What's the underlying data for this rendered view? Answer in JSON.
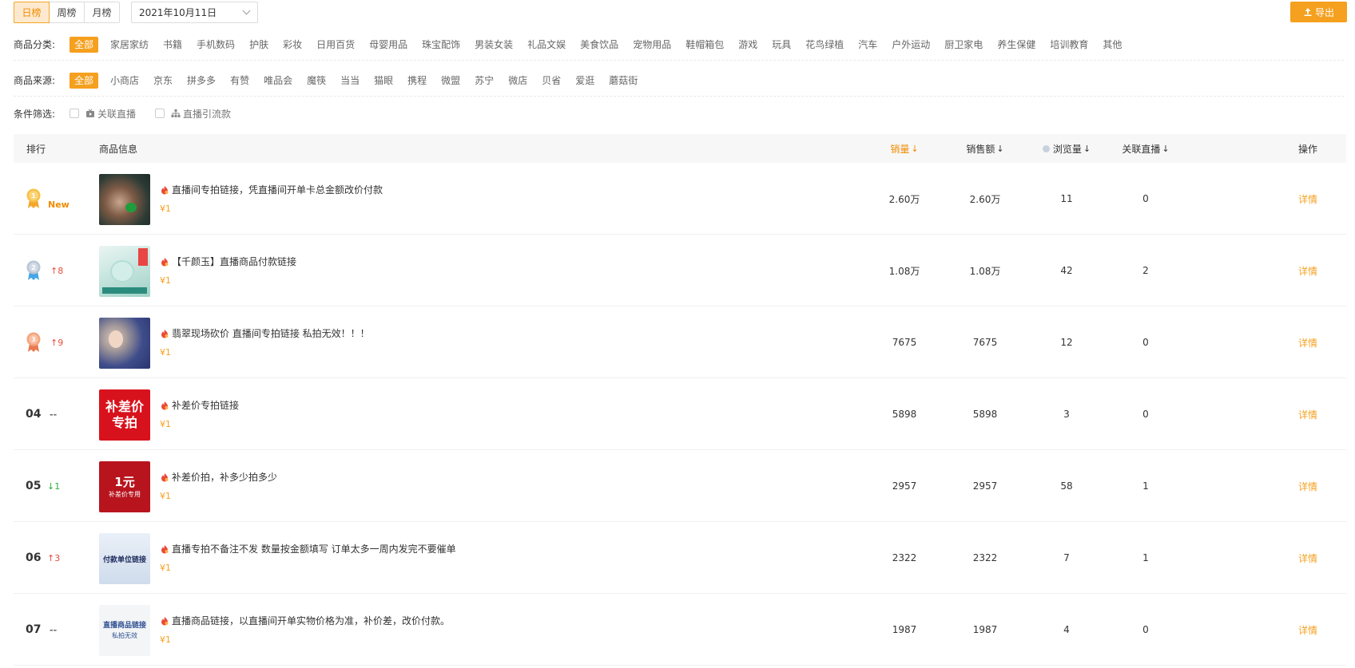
{
  "tabs": [
    {
      "label": "日榜",
      "active": true
    },
    {
      "label": "周榜",
      "active": false
    },
    {
      "label": "月榜",
      "active": false
    }
  ],
  "date_picker": {
    "value": "2021年10月11日"
  },
  "export_label": "导出",
  "category": {
    "label": "商品分类:",
    "items": [
      "全部",
      "家居家纺",
      "书籍",
      "手机数码",
      "护肤",
      "彩妆",
      "日用百货",
      "母婴用品",
      "珠宝配饰",
      "男装女装",
      "礼品文娱",
      "美食饮品",
      "宠物用品",
      "鞋帽箱包",
      "游戏",
      "玩具",
      "花鸟绿植",
      "汽车",
      "户外运动",
      "厨卫家电",
      "养生保健",
      "培训教育",
      "其他"
    ]
  },
  "source": {
    "label": "商品来源:",
    "items": [
      "全部",
      "小商店",
      "京东",
      "拼多多",
      "有赞",
      "唯品会",
      "魔筷",
      "当当",
      "猫眼",
      "携程",
      "微盟",
      "苏宁",
      "微店",
      "贝省",
      "爱逛",
      "蘑菇街"
    ]
  },
  "conditions": {
    "label": "条件筛选:",
    "items": [
      {
        "label": "关联直播",
        "icon": "live-video-icon"
      },
      {
        "label": "直播引流款",
        "icon": "sitemap-icon"
      }
    ]
  },
  "table": {
    "headers": {
      "rank": "排行",
      "info": "商品信息",
      "sales": "销量",
      "amount": "销售额",
      "views": "浏览量",
      "live": "关联直播",
      "action": "操作"
    },
    "sort_arrow": "↓",
    "rows": [
      {
        "rank": "1",
        "delta": "New",
        "delta_type": "new",
        "title": "直播间专拍链接，凭直播间开单卡总金额改价付款",
        "price": "¥1",
        "sales": "2.60万",
        "amount": "2.60万",
        "views": "11",
        "live": "0",
        "action": "详情"
      },
      {
        "rank": "2",
        "delta": "8",
        "delta_type": "up",
        "title": "【千颜玉】直播商品付款链接",
        "price": "¥1",
        "sales": "1.08万",
        "amount": "1.08万",
        "views": "42",
        "live": "2",
        "action": "详情"
      },
      {
        "rank": "3",
        "delta": "9",
        "delta_type": "up",
        "title": "翡翠现场砍价 直播间专拍链接 私拍无效！！！",
        "price": "¥1",
        "sales": "7675",
        "amount": "7675",
        "views": "12",
        "live": "0",
        "action": "详情"
      },
      {
        "rank": "04",
        "delta": "--",
        "delta_type": "flat",
        "title": "补差价专拍链接",
        "price": "¥1",
        "sales": "5898",
        "amount": "5898",
        "views": "3",
        "live": "0",
        "action": "详情",
        "thumb_text": [
          "补差价",
          "专拍"
        ]
      },
      {
        "rank": "05",
        "delta": "1",
        "delta_type": "down",
        "title": "补差价拍，补多少拍多少",
        "price": "¥1",
        "sales": "2957",
        "amount": "2957",
        "views": "58",
        "live": "1",
        "action": "详情",
        "thumb_text": [
          "1元",
          "补差价专用"
        ]
      },
      {
        "rank": "06",
        "delta": "3",
        "delta_type": "up",
        "title": "直播专拍不备注不发 数量按金额填写 订单太多一周内发完不要催单",
        "price": "¥1",
        "sales": "2322",
        "amount": "2322",
        "views": "7",
        "live": "1",
        "action": "详情",
        "thumb_text": [
          "付款单位链接"
        ]
      },
      {
        "rank": "07",
        "delta": "--",
        "delta_type": "flat",
        "title": "直播商品链接，以直播间开单实物价格为准，补价差，改价付款。",
        "price": "¥1",
        "sales": "1987",
        "amount": "1987",
        "views": "4",
        "live": "0",
        "action": "详情",
        "thumb_text": [
          "直播商品链接",
          "私拍无效"
        ]
      }
    ]
  },
  "colors": {
    "accent": "#f5a01e",
    "up": "#e74c3c",
    "down": "#2eaa36"
  }
}
